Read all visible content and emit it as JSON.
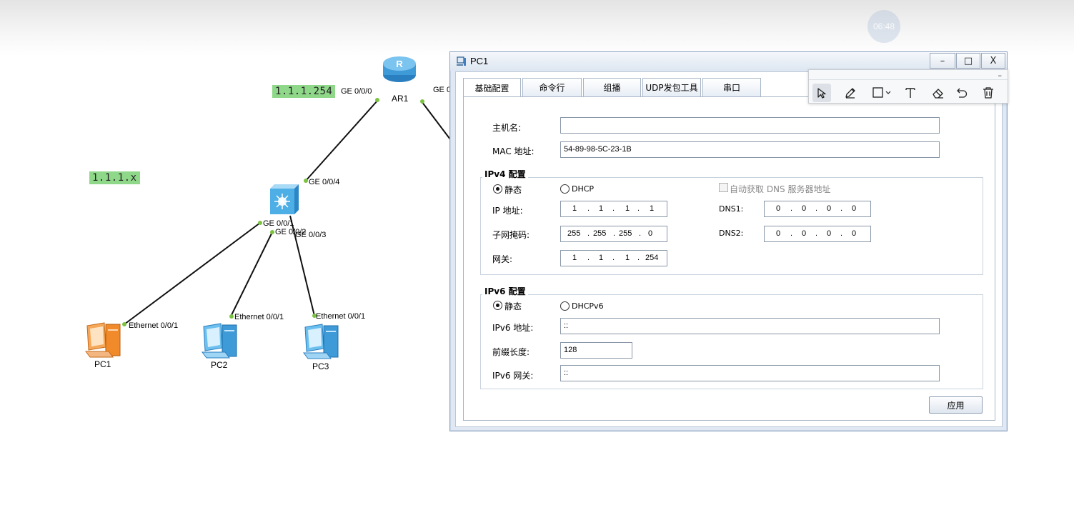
{
  "overlay": {
    "timer_text": "06:48"
  },
  "topology": {
    "ip_labels": {
      "router_ip": "1.1.1.254",
      "subnet": "1.1.1.x"
    },
    "devices": {
      "router": "AR1",
      "pc1": "PC1",
      "pc2": "PC2",
      "pc3": "PC3"
    },
    "ports": {
      "ar1_ge000": "GE 0/0/0",
      "ar1_right": "GE 0",
      "sw_ge004": "GE 0/0/4",
      "sw_ge001": "GE 0/0/1",
      "sw_ge002": "GE 0/0/2",
      "sw_ge003": "GE 0/0/3",
      "pc1_eth": "Ethernet 0/0/1",
      "pc2_eth": "Ethernet 0/0/1",
      "pc3_eth": "Ethernet 0/0/1"
    },
    "colors": {
      "label_bg": "#8fd88a",
      "link_dot": "#7cc242",
      "router_blue": "#3f9ad8",
      "pc_orange": "#f08a2a"
    }
  },
  "window": {
    "title": "PC1",
    "controls": {
      "minimize": "–",
      "maximize": "□",
      "close": "X"
    },
    "tabs": [
      "基础配置",
      "命令行",
      "组播",
      "UDP发包工具",
      "串口"
    ],
    "active_tab": "基础配置",
    "basic": {
      "hostname_label": "主机名:",
      "hostname_value": "",
      "mac_label": "MAC 地址:",
      "mac_value": "54-89-98-5C-23-1B",
      "ipv4": {
        "title": "IPv4 配置",
        "static_label": "静态",
        "dhcp_label": "DHCP",
        "auto_dns_label": "自动获取 DNS 服务器地址",
        "ip_label": "IP 地址:",
        "ip": [
          "1",
          "1",
          "1",
          "1"
        ],
        "mask_label": "子网掩码:",
        "mask": [
          "255",
          "255",
          "255",
          "0"
        ],
        "gateway_label": "网关:",
        "gateway": [
          "1",
          "1",
          "1",
          "254"
        ],
        "dns1_label": "DNS1:",
        "dns1": [
          "0",
          "0",
          "0",
          "0"
        ],
        "dns2_label": "DNS2:",
        "dns2": [
          "0",
          "0",
          "0",
          "0"
        ],
        "mode": "静态"
      },
      "ipv6": {
        "title": "IPv6 配置",
        "static_label": "静态",
        "dhcp_label": "DHCPv6",
        "ip_label": "IPv6 地址:",
        "ip_value": "::",
        "prefix_label": "前缀长度:",
        "prefix_value": "128",
        "gateway_label": "IPv6 网关:",
        "gateway_value": "::",
        "mode": "静态"
      },
      "apply_label": "应用"
    }
  },
  "annotation_toolbar": {
    "minimize": "–",
    "tools": [
      "select-tool",
      "pen-tool",
      "shape-tool",
      "text-tool",
      "eraser-tool",
      "undo-tool",
      "delete-tool"
    ],
    "selected": "select-tool"
  }
}
